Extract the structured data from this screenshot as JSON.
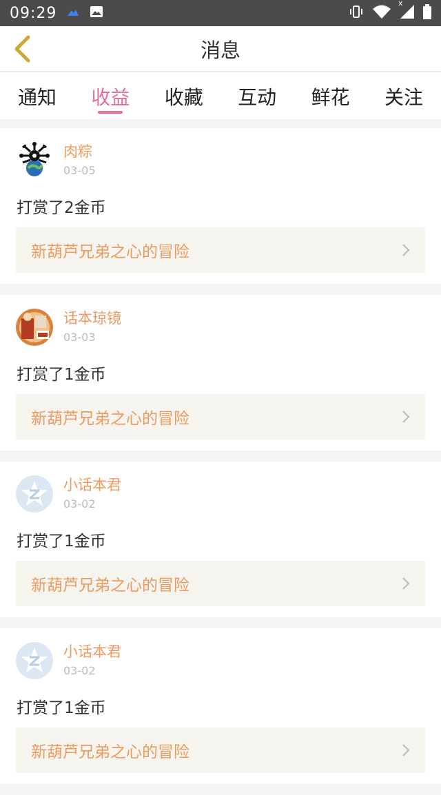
{
  "status_bar": {
    "time": "09:29",
    "x_label": "x"
  },
  "header": {
    "title": "消息"
  },
  "tabs": [
    {
      "label": "通知",
      "active": false
    },
    {
      "label": "收益",
      "active": true
    },
    {
      "label": "收藏",
      "active": false
    },
    {
      "label": "互动",
      "active": false
    },
    {
      "label": "鲜花",
      "active": false
    },
    {
      "label": "关注",
      "active": false
    }
  ],
  "messages": [
    {
      "username": "肉粽",
      "date": "03-05",
      "text": "打赏了2金币",
      "work_title": "新葫芦兄弟之心的冒险",
      "avatar": "virus-globe-avatar"
    },
    {
      "username": "话本琼镜",
      "date": "03-03",
      "text": "打赏了1金币",
      "work_title": "新葫芦兄弟之心的冒险",
      "avatar": "illustrated-avatar"
    },
    {
      "username": "小话本君",
      "date": "03-02",
      "text": "打赏了1金币",
      "work_title": "新葫芦兄弟之心的冒险",
      "avatar": "default-z-avatar"
    },
    {
      "username": "小话本君",
      "date": "03-02",
      "text": "打赏了1金币",
      "work_title": "新葫芦兄弟之心的冒险",
      "avatar": "default-z-avatar"
    }
  ],
  "colors": {
    "accent_pink": "#e56c9c",
    "accent_orange": "#ef9a60",
    "status_bar": "#4b4b4b",
    "link_bg": "#f5f4ee"
  }
}
